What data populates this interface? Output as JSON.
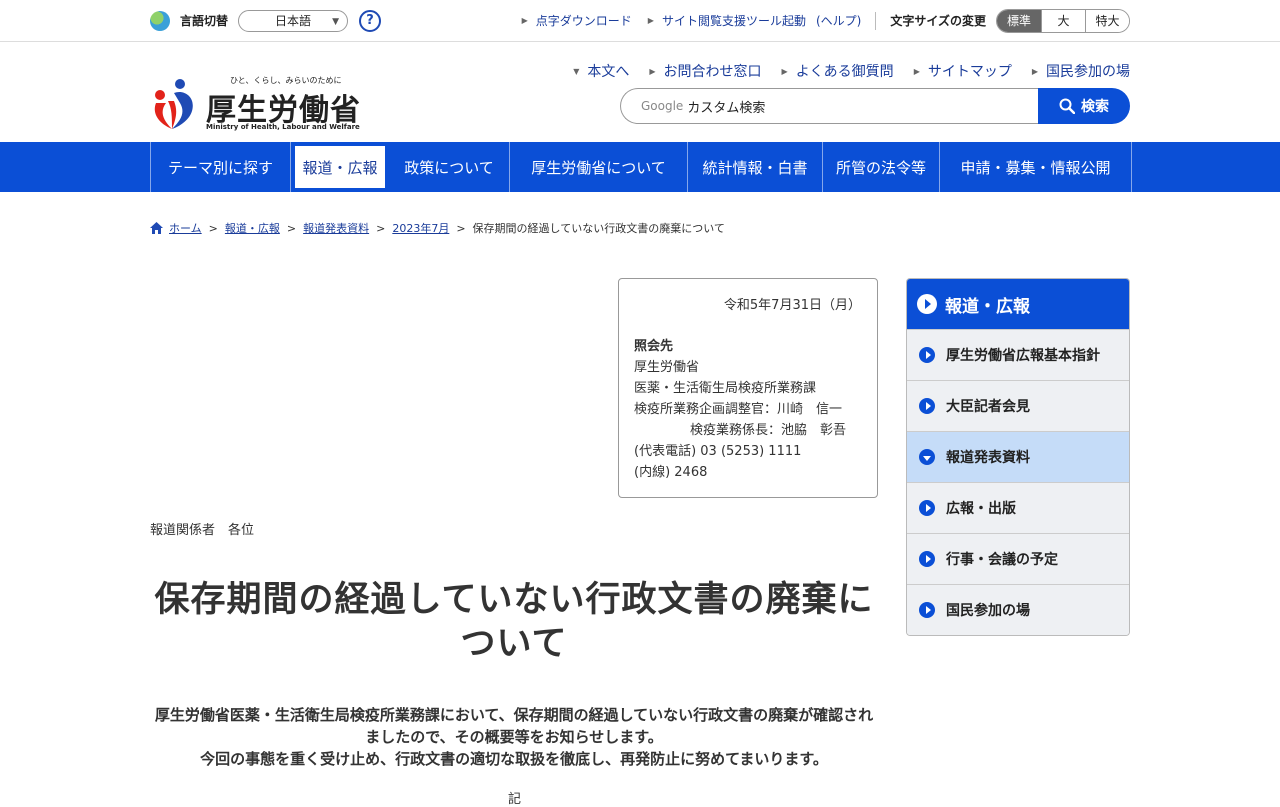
{
  "utility": {
    "lang_label": "言語切替",
    "lang_value": "日本語",
    "help": "?",
    "links": [
      "点字ダウンロード",
      "サイト閲覧支援ツール起動",
      "(ヘルプ)"
    ],
    "font_size_label": "文字サイズの変更",
    "font_sizes": [
      "標準",
      "大",
      "特大"
    ]
  },
  "logo": {
    "tagline": "ひと、くらし、みらいのために",
    "name": "厚生労働省",
    "en": "Ministry of Health, Labour and Welfare"
  },
  "header_links": [
    "本文へ",
    "お問合わせ窓口",
    "よくある御質問",
    "サイトマップ",
    "国民参加の場"
  ],
  "search": {
    "google": "Google",
    "placeholder": "カスタム検索",
    "button": "検索"
  },
  "nav": [
    "テーマ別に探す",
    "報道・広報",
    "政策について",
    "厚生労働省について",
    "統計情報・白書",
    "所管の法令等",
    "申請・募集・情報公開"
  ],
  "breadcrumb": [
    "ホーム",
    "報道・広報",
    "報道発表資料",
    "2023年7月",
    "保存期間の経過していない行政文書の廃棄について"
  ],
  "contact": {
    "date": "令和5年7月31日（月）",
    "heading": "照会先",
    "lines": [
      "厚生労働省",
      "医薬・生活衛生局検疫所業務課",
      "検疫所業務企画調整官：川崎　信一",
      "検疫業務係長：池脇　彰吾",
      "(代表電話) 03 (5253) 1111",
      "(内線) 2468"
    ]
  },
  "addressee": "報道関係者　各位",
  "title": "保存期間の経過していない行政文書の廃棄について",
  "lead": [
    "厚生労働省医薬・生活衛生局検疫所業務課において、保存期間の経過していない行政文書の廃棄が確認されましたので、その概要等をお知らせします。",
    "今回の事態を重く受け止め、行政文書の適切な取扱を徹底し、再発防止に努めてまいります。"
  ],
  "ki": "記",
  "side": {
    "heading": "報道・広報",
    "items": [
      "厚生労働省広報基本指針",
      "大臣記者会見",
      "報道発表資料",
      "広報・出版",
      "行事・会議の予定",
      "国民参加の場"
    ]
  }
}
